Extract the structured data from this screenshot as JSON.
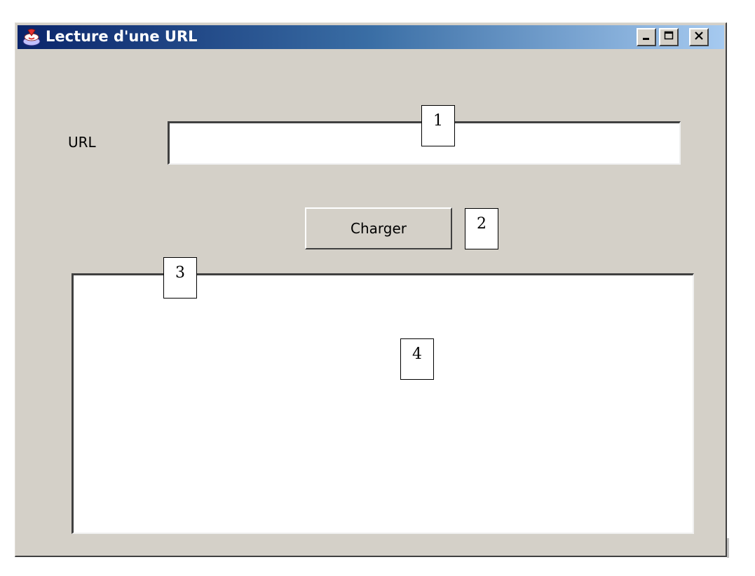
{
  "window": {
    "title": "Lecture d'une URL",
    "controls": {
      "minimize": "minimize-icon",
      "maximize": "maximize-icon",
      "close": "close-icon"
    }
  },
  "form": {
    "url_label": "URL",
    "url_value": "",
    "load_button": "Charger",
    "content_value": ""
  },
  "annotations": [
    "1",
    "2",
    "3",
    "4"
  ],
  "colors": {
    "window_bg": "#d4d0c8",
    "title_start": "#0a246a",
    "title_end": "#a6caf0"
  }
}
